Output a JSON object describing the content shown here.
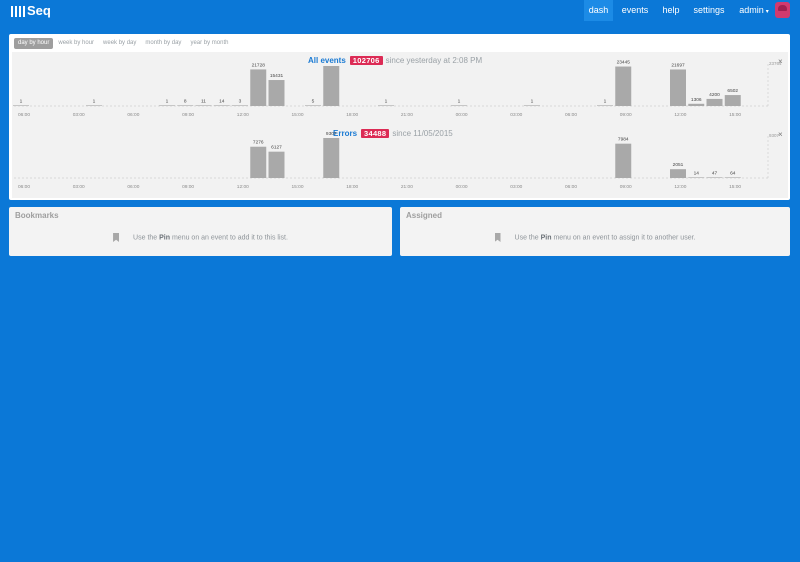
{
  "nav": {
    "logo_text": "Seq",
    "items": [
      {
        "label": "dash",
        "active": true
      },
      {
        "label": "events",
        "active": false
      },
      {
        "label": "help",
        "active": false
      },
      {
        "label": "settings",
        "active": false
      }
    ],
    "user_label": "admin",
    "caret": "▾"
  },
  "range_tabs": [
    {
      "label": "day by hour",
      "active": true
    },
    {
      "label": "week by hour",
      "active": false
    },
    {
      "label": "week by day",
      "active": false
    },
    {
      "label": "month by day",
      "active": false
    },
    {
      "label": "year by month",
      "active": false
    }
  ],
  "charts": [
    {
      "title": "All events",
      "count": "102706",
      "since": "since yesterday at 2:08 PM",
      "close": "×"
    },
    {
      "title": "Errors",
      "count": "34488",
      "since": "since 11/05/2015",
      "close": "×"
    }
  ],
  "chart_data": [
    {
      "type": "bar",
      "title": "All events",
      "x_ticks": [
        "06:00",
        "03:00",
        "06:00",
        "09:00",
        "12:00",
        "15:00",
        "18:00",
        "21:00",
        "00:00",
        "03:00",
        "06:00",
        "09:00",
        "12:00",
        "15:00"
      ],
      "ymax_label": "23764",
      "ylim": [
        0,
        23764
      ],
      "bars": [
        {
          "slot": 0,
          "value": 1,
          "label": "1"
        },
        {
          "slot": 4,
          "value": 1,
          "label": "1"
        },
        {
          "slot": 8,
          "value": 1,
          "label": "1"
        },
        {
          "slot": 9,
          "value": 8,
          "label": "8"
        },
        {
          "slot": 10,
          "value": 11,
          "label": "11"
        },
        {
          "slot": 11,
          "value": 14,
          "label": "14"
        },
        {
          "slot": 12,
          "value": 3,
          "label": "3"
        },
        {
          "slot": 13,
          "value": 21728,
          "label": "21728"
        },
        {
          "slot": 14,
          "value": 15431,
          "label": "15431"
        },
        {
          "slot": 16,
          "value": 5,
          "label": "5"
        },
        {
          "slot": 17,
          "value": 23764,
          "label": ""
        },
        {
          "slot": 20,
          "value": 1,
          "label": "1"
        },
        {
          "slot": 24,
          "value": 1,
          "label": "1"
        },
        {
          "slot": 28,
          "value": 1,
          "label": "1"
        },
        {
          "slot": 32,
          "value": 1,
          "label": "1"
        },
        {
          "slot": 33,
          "value": 23445,
          "label": "23445"
        },
        {
          "slot": 36,
          "value": 21697,
          "label": "21697"
        },
        {
          "slot": 37,
          "value": 1306,
          "label": "1306"
        },
        {
          "slot": 38,
          "value": 4200,
          "label": "4200"
        },
        {
          "slot": 39,
          "value": 6502,
          "label": "6502"
        }
      ]
    },
    {
      "type": "bar",
      "title": "Errors",
      "x_ticks": [
        "06:00",
        "03:00",
        "06:00",
        "09:00",
        "12:00",
        "15:00",
        "18:00",
        "21:00",
        "00:00",
        "03:00",
        "06:00",
        "09:00",
        "12:00",
        "15:00"
      ],
      "ymax_label": "9307",
      "ylim": [
        0,
        9307
      ],
      "bars": [
        {
          "slot": 13,
          "value": 7276,
          "label": "7276"
        },
        {
          "slot": 14,
          "value": 6127,
          "label": "6127"
        },
        {
          "slot": 17,
          "value": 9307,
          "label": "9307"
        },
        {
          "slot": 33,
          "value": 7984,
          "label": "7984"
        },
        {
          "slot": 36,
          "value": 2051,
          "label": "2051"
        },
        {
          "slot": 37,
          "value": 14,
          "label": "14"
        },
        {
          "slot": 38,
          "value": 47,
          "label": "47"
        },
        {
          "slot": 39,
          "value": 64,
          "label": "64"
        }
      ]
    }
  ],
  "bookmarks": {
    "title": "Bookmarks",
    "icon": "bookmark-icon",
    "text_before": "Use the",
    "pin_word": "Pin",
    "text_after": "menu on an event to add it to this list."
  },
  "assigned": {
    "title": "Assigned",
    "icon": "bookmark-icon",
    "text_before": "Use the",
    "pin_word": "Pin",
    "text_after": "menu on an event to assign it to another user."
  },
  "colors": {
    "background": "#0b78d7",
    "nav_active": "#1c8be6",
    "badge": "#dc2b55",
    "title_link": "#1a7ad3",
    "bar": "#a9a9a9"
  }
}
